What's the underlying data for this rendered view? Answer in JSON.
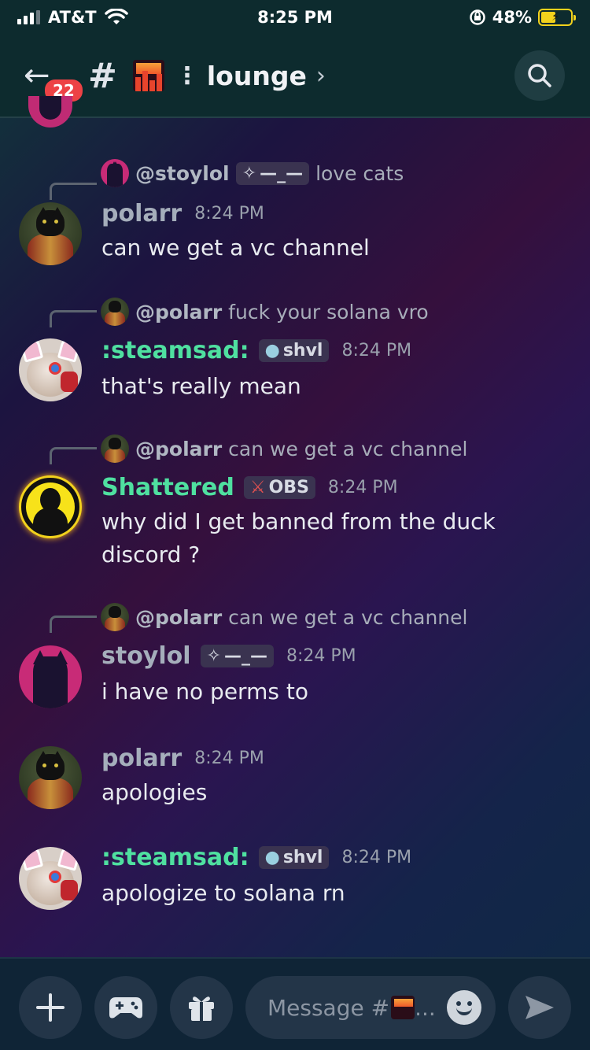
{
  "status_bar": {
    "carrier": "AT&T",
    "time": "8:25 PM",
    "battery": "48%",
    "icons": [
      "signal-icon",
      "wifi-icon",
      "orientation-lock-icon",
      "battery-charging-icon"
    ]
  },
  "header": {
    "unread_count": "22",
    "channel_prefix": "#",
    "channel_separator": "⋮",
    "channel_name": "lounge",
    "chevron": "›"
  },
  "messages": [
    {
      "reply": {
        "name": "@stoylol",
        "tag": "—_—",
        "text": "love cats"
      },
      "author": "polarr",
      "author_color": "#a5aebb",
      "time": "8:24 PM",
      "text": "can we get a vc channel"
    },
    {
      "reply": {
        "name": "@polarr",
        "text": "fuck your solana vro"
      },
      "author": ":steamsad:",
      "author_color": "#4fe0a0",
      "tag": "shvl",
      "time": "8:24 PM",
      "text": "that's really mean"
    },
    {
      "reply": {
        "name": "@polarr",
        "text": "can we get a vc channel"
      },
      "author": "Shattered",
      "author_color": "#4fe0a0",
      "tag": "OBS",
      "time": "8:24 PM",
      "text": "why did I get banned from the duck discord ?"
    },
    {
      "reply": {
        "name": "@polarr",
        "text": "can we get a vc channel"
      },
      "author": "stoylol",
      "author_color": "#a5aebb",
      "tag": "—_—",
      "time": "8:24 PM",
      "text": "i have no perms to"
    },
    {
      "author": "polarr",
      "author_color": "#a5aebb",
      "time": "8:24 PM",
      "text": "apologies"
    },
    {
      "author": ":steamsad:",
      "author_color": "#4fe0a0",
      "tag": "shvl",
      "time": "8:24 PM",
      "text": "apologize to solana rn"
    }
  ],
  "composer": {
    "placeholder": "Message #",
    "placeholder_suffix": "..."
  },
  "colors": {
    "header_bg": "#0d2b2e",
    "accent_green": "#4fe0a0",
    "badge_red": "#ed4245"
  }
}
